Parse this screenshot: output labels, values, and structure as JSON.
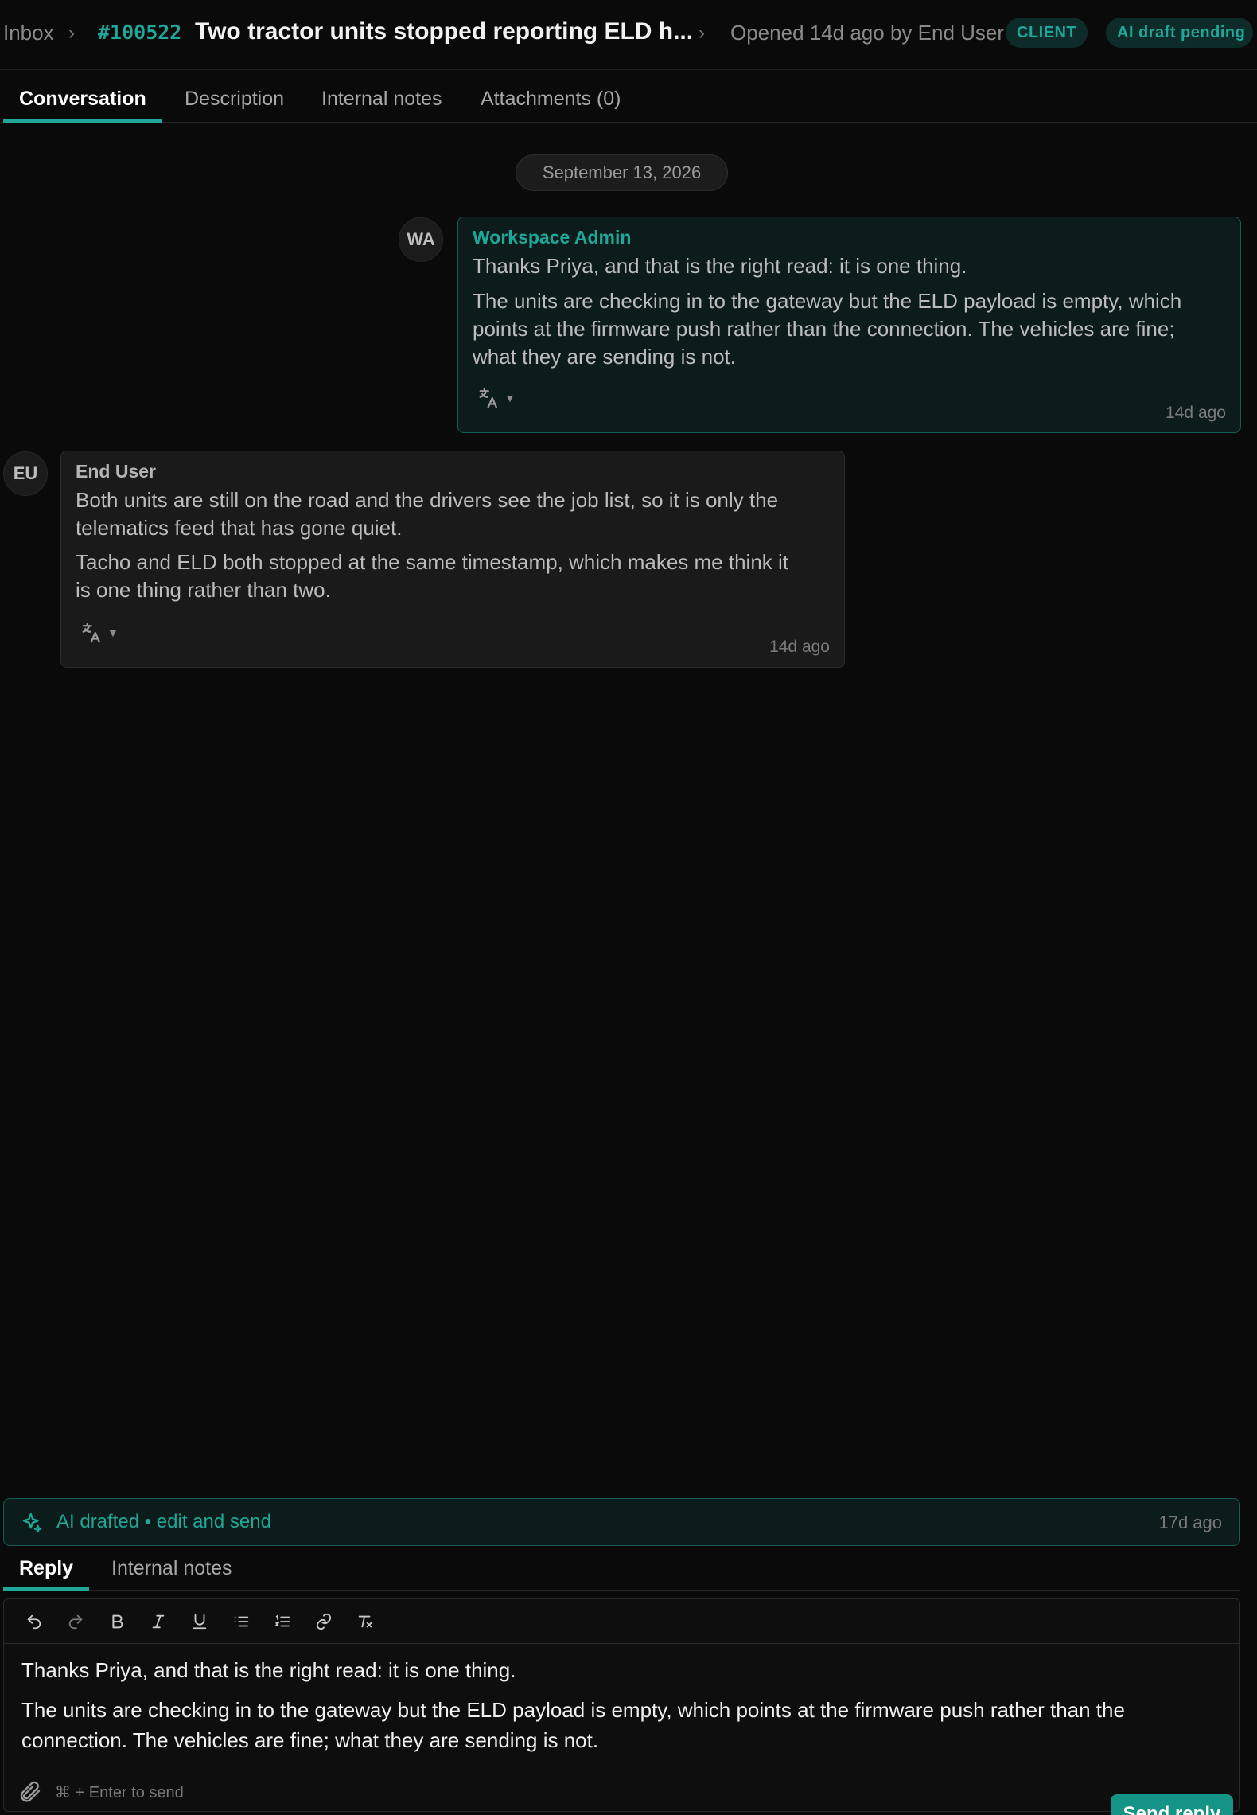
{
  "header": {
    "breadcrumb_root": "Inbox",
    "ticket_id": "#100522",
    "ticket_title": "Two tractor units stopped reporting ELD h...",
    "opened_text": "Opened 14d ago by End User",
    "badges": [
      "CLIENT",
      "AI draft pending"
    ]
  },
  "tabs": [
    {
      "label": "Conversation",
      "active": true
    },
    {
      "label": "Description",
      "active": false
    },
    {
      "label": "Internal notes",
      "active": false
    },
    {
      "label": "Attachments (0)",
      "active": false
    }
  ],
  "date_divider": "September 13, 2026",
  "messages": [
    {
      "avatar": "WA",
      "sender": "Workspace Admin",
      "paragraphs": [
        "Thanks Priya, and that is the right read: it is one thing.",
        "The units are checking in to the gateway but the ELD payload is empty, which points at the firmware push rather than the connection. The vehicles are fine; what they are sending is not."
      ],
      "time": "14d ago"
    },
    {
      "avatar": "EU",
      "sender": "End User",
      "paragraphs": [
        "Both units are still on the road and the drivers see the job list, so it is only the telematics feed that has gone quiet.",
        "Tacho and ELD both stopped at the same timestamp, which makes me think it is one thing rather than two."
      ],
      "time": "14d ago"
    }
  ],
  "ai_banner": {
    "label": "AI drafted • edit and send",
    "time": "17d ago"
  },
  "reply_tabs": [
    {
      "label": "Reply",
      "active": true
    },
    {
      "label": "Internal notes",
      "active": false
    }
  ],
  "toolbar_icons": [
    "undo-icon",
    "redo-icon",
    "bold-icon",
    "italic-icon",
    "underline-icon",
    "bullet-list-icon",
    "numbered-list-icon",
    "link-icon",
    "clear-format-icon"
  ],
  "editor": {
    "paragraphs": [
      "Thanks Priya, and that is the right read: it is one thing.",
      "The units are checking in to the gateway but the ELD payload is empty, which points at the firmware push rather than the connection. The vehicles are fine; what they are sending is not."
    ],
    "hint": "⌘ + Enter to send",
    "send_label": "Send reply"
  },
  "colors": {
    "accent": "#1fa89a",
    "background": "#0a0a0a",
    "send_button": "#139486"
  }
}
